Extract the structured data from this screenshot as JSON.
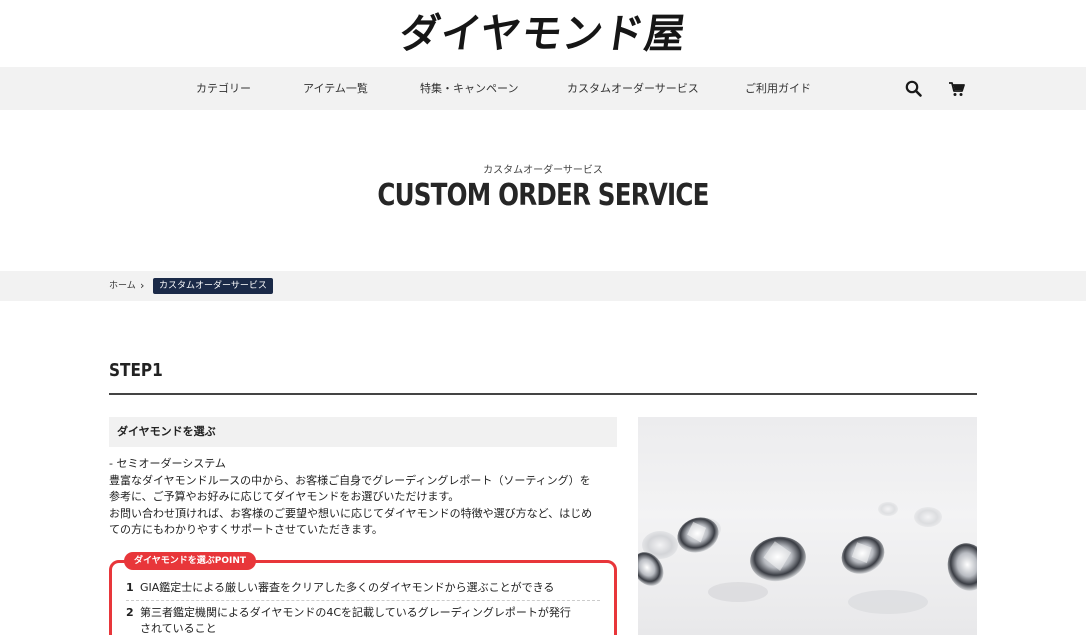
{
  "brand": {
    "logo_text": "ダイヤモンド屋"
  },
  "nav": {
    "items": [
      "カテゴリー",
      "アイテム一覧",
      "特集・キャンペーン",
      "カスタムオーダーサービス",
      "ご利用ガイド"
    ],
    "icons": [
      "search-icon",
      "cart-icon"
    ]
  },
  "hero": {
    "subtitle": "カスタムオーダーサービス",
    "title": "CUSTOM ORDER SERVICE"
  },
  "breadcrumb": {
    "home": "ホーム",
    "separator": "›",
    "current": "カスタムオーダーサービス"
  },
  "step": {
    "title": "STEP1",
    "heading": "ダイヤモンドを選ぶ",
    "description": [
      "- セミオーダーシステム",
      "豊富なダイヤモンドルースの中から、お客様ご自身でグレーディングレポート（ソーティング）を",
      "参考に、ご予算やお好みに応じてダイヤモンドをお選びいただけます。",
      "お問い合わせ頂ければ、お客様のご要望や想いに応じてダイヤモンドの特徴や選び方など、はじめ",
      "ての方にもわかりやすくサポートさせていただきます。"
    ],
    "point_tag": "ダイヤモンドを選ぶPOINT",
    "points": [
      {
        "num": "1",
        "text": "GIA鑑定士による厳しい審査をクリアした多くのダイヤモンドから選ぶことができる"
      },
      {
        "num": "2",
        "text": "第三者鑑定機関によるダイヤモンドの4Cを記載しているグレーディングレポートが発行",
        "text2": "されていること"
      }
    ]
  },
  "colors": {
    "accent_red": "#e8363a",
    "breadcrumb_navy": "#1b2a48",
    "nav_bg": "#f2f2f2"
  }
}
